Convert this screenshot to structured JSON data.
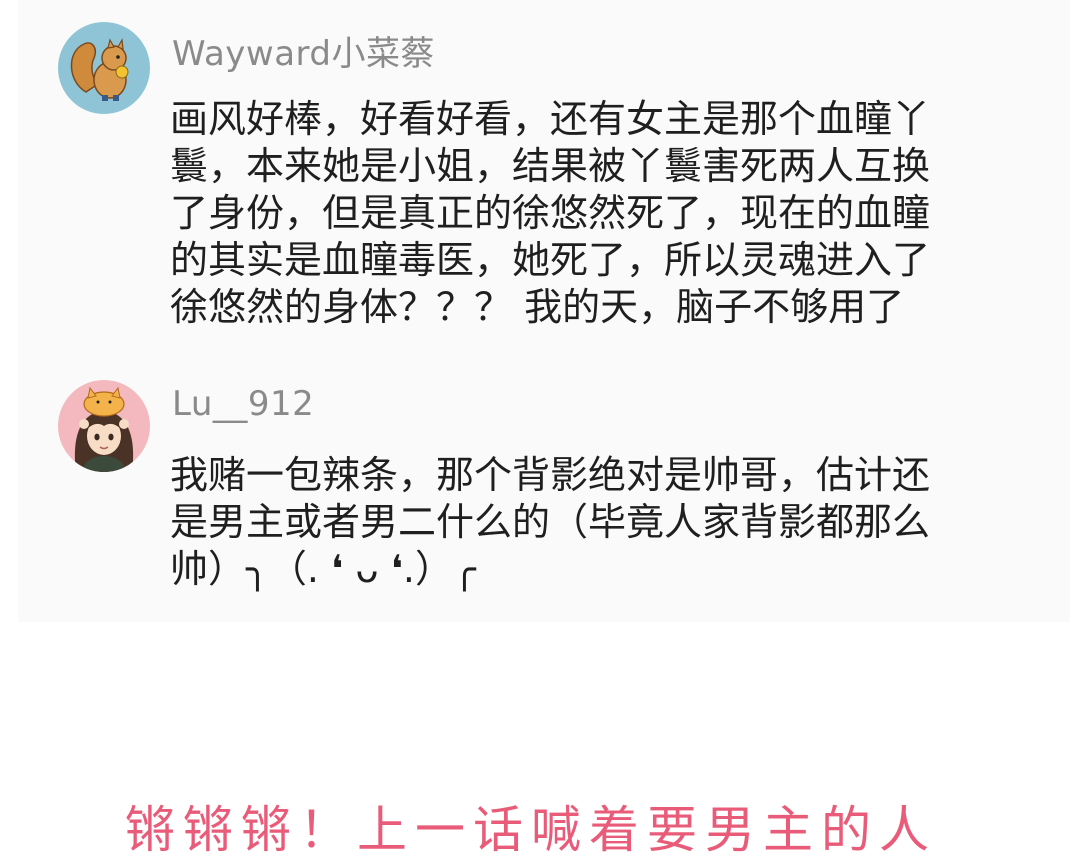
{
  "comments": [
    {
      "username": "Wayward小菜蔡",
      "avatar_icon": "squirrel-avatar-icon",
      "lines": [
        "画风好棒，好看好看，还有女主是那个血瞳丫",
        "鬟，本来她是小姐，结果被丫鬟害死两人互换",
        "了身份，但是真正的徐悠然死了，现在的血瞳",
        "的其实是血瞳毒医，她死了，所以灵魂进入了",
        "徐悠然的身体？？？ 我的天，脑子不够用了"
      ]
    },
    {
      "username": "Lu__912",
      "avatar_icon": "anime-girl-avatar-icon",
      "lines": [
        "我赌一包辣条，那个背影绝对是帅哥，估计还",
        "是男主或者男二什么的（毕竟人家背影都那么",
        "帅）╮（. ❛ ᴗ ❛.）╭"
      ]
    }
  ],
  "caption": "锵锵锵！上一话喊着要男主的人",
  "colors": {
    "caption": "#e85c7a",
    "username": "#8a8a8a",
    "text": "#1f1f1f",
    "panel": "#fafafa"
  }
}
